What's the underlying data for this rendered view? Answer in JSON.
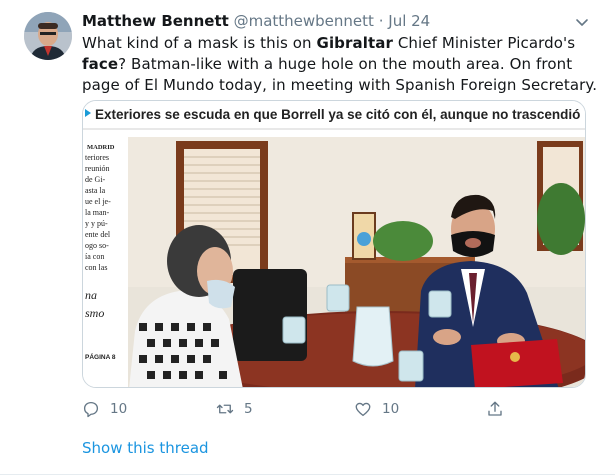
{
  "author": {
    "name": "Matthew Bennett",
    "handle": "@matthewbennett",
    "separator": "·",
    "date": "Jul 24"
  },
  "tweet": {
    "text_1": "What kind of a mask is this on ",
    "bold_1": "Gibraltar",
    "text_2": " Chief Minister Picardo's ",
    "bold_2": "face",
    "text_3": "? Batman-like with a huge hole on the mouth area. On front page of El Mundo today, in meeting with Spanish Foreign Secretary."
  },
  "media": {
    "headline": "Exteriores se escuda en que Borrell ya se citó con él, aunque no trascendió",
    "column_lines": [
      "MADRID",
      "teriores",
      "reunión",
      "de Gi-",
      "asta la",
      "ue el je-",
      "la man-",
      "y y pú-",
      "ente del",
      "ogo so-",
      "ía con",
      "con las"
    ],
    "column_italic": [
      "na",
      "smo"
    ],
    "page_label": "PÁGINA 8"
  },
  "actions": {
    "reply_count": "10",
    "retweet_count": "5",
    "like_count": "10"
  },
  "show_thread": "Show this thread",
  "icons": {
    "reply": "reply-icon",
    "retweet": "retweet-icon",
    "like": "heart-icon",
    "share": "share-icon",
    "more": "chevron-down-icon"
  },
  "colors": {
    "link": "#1b95e0",
    "muted": "#657786",
    "text": "#14171a"
  }
}
